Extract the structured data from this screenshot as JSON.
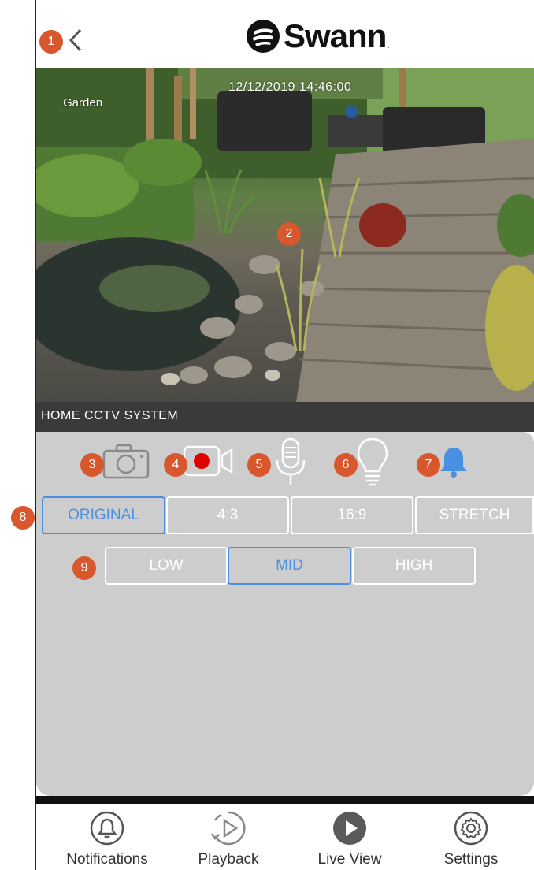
{
  "header": {
    "logo_text": "Swann",
    "logo_mark": "."
  },
  "video": {
    "camera_label": "Garden",
    "timestamp": "12/12/2019 14:46:00"
  },
  "camera_bar": {
    "title": "HOME CCTV SYSTEM"
  },
  "controls": {
    "icons": [
      "camera-icon",
      "record-icon",
      "microphone-icon",
      "light-bulb-icon",
      "bell-icon"
    ],
    "accent_color": "#4a90e2",
    "record_color": "#e00000",
    "aspect_options": [
      "ORIGINAL",
      "4:3",
      "16:9",
      "STRETCH"
    ],
    "aspect_selected": "ORIGINAL",
    "quality_options": [
      "LOW",
      "MID",
      "HIGH"
    ],
    "quality_selected": "MID"
  },
  "badges": [
    "1",
    "2",
    "3",
    "4",
    "5",
    "6",
    "7",
    "8",
    "9"
  ],
  "nav": {
    "items": [
      {
        "label": "Notifications",
        "icon": "bell-icon"
      },
      {
        "label": "Playback",
        "icon": "playback-icon"
      },
      {
        "label": "Live View",
        "icon": "play-icon"
      },
      {
        "label": "Settings",
        "icon": "gear-icon"
      }
    ]
  }
}
